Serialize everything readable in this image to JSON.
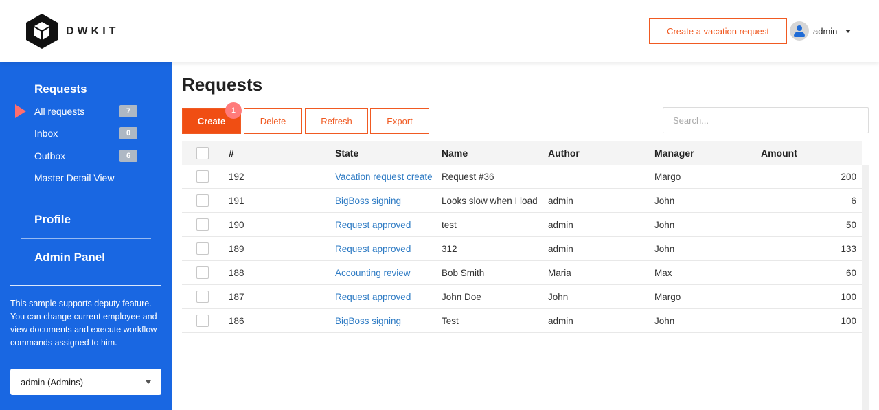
{
  "header": {
    "logo_text": "DWKIT",
    "vacation_button": "Create a vacation request",
    "user_name": "admin"
  },
  "sidebar": {
    "requests_title": "Requests",
    "items": [
      {
        "label": "All requests",
        "count": "7",
        "active": true
      },
      {
        "label": "Inbox",
        "count": "0"
      },
      {
        "label": "Outbox",
        "count": "6"
      },
      {
        "label": "Master Detail View"
      }
    ],
    "profile": "Profile",
    "admin_panel": "Admin Panel",
    "note": "This sample supports deputy feature. You can change current employee and view documents and execute workflow commands assigned to him.",
    "employee_select": "admin (Admins)"
  },
  "main": {
    "title": "Requests",
    "toolbar": {
      "create": "Create",
      "create_badge": "1",
      "delete": "Delete",
      "refresh": "Refresh",
      "export": "Export"
    },
    "search_placeholder": "Search...",
    "columns": [
      "#",
      "State",
      "Name",
      "Author",
      "Manager",
      "Amount"
    ],
    "rows": [
      {
        "id": "192",
        "state": "Vacation request created",
        "name": "Request #36",
        "author": "",
        "manager": "Margo",
        "amount": "200"
      },
      {
        "id": "191",
        "state": "BigBoss signing",
        "name": "Looks slow when I load",
        "author": "admin",
        "manager": "John",
        "amount": "6"
      },
      {
        "id": "190",
        "state": "Request approved",
        "name": "test",
        "author": "admin",
        "manager": "John",
        "amount": "50"
      },
      {
        "id": "189",
        "state": "Request approved",
        "name": "312",
        "author": "admin",
        "manager": "John",
        "amount": "133"
      },
      {
        "id": "188",
        "state": "Accounting review",
        "name": "Bob Smith",
        "author": "Maria",
        "manager": "Max",
        "amount": "60"
      },
      {
        "id": "187",
        "state": "Request approved",
        "name": "John Doe",
        "author": "John",
        "manager": "Margo",
        "amount": "100"
      },
      {
        "id": "186",
        "state": "BigBoss signing",
        "name": "Test",
        "author": "admin",
        "manager": "John",
        "amount": "100"
      }
    ]
  },
  "colors": {
    "sidebar_bg": "#1967e2",
    "accent": "#f05a22",
    "link": "#2e7bc4",
    "active_marker": "#ff6e6e"
  }
}
